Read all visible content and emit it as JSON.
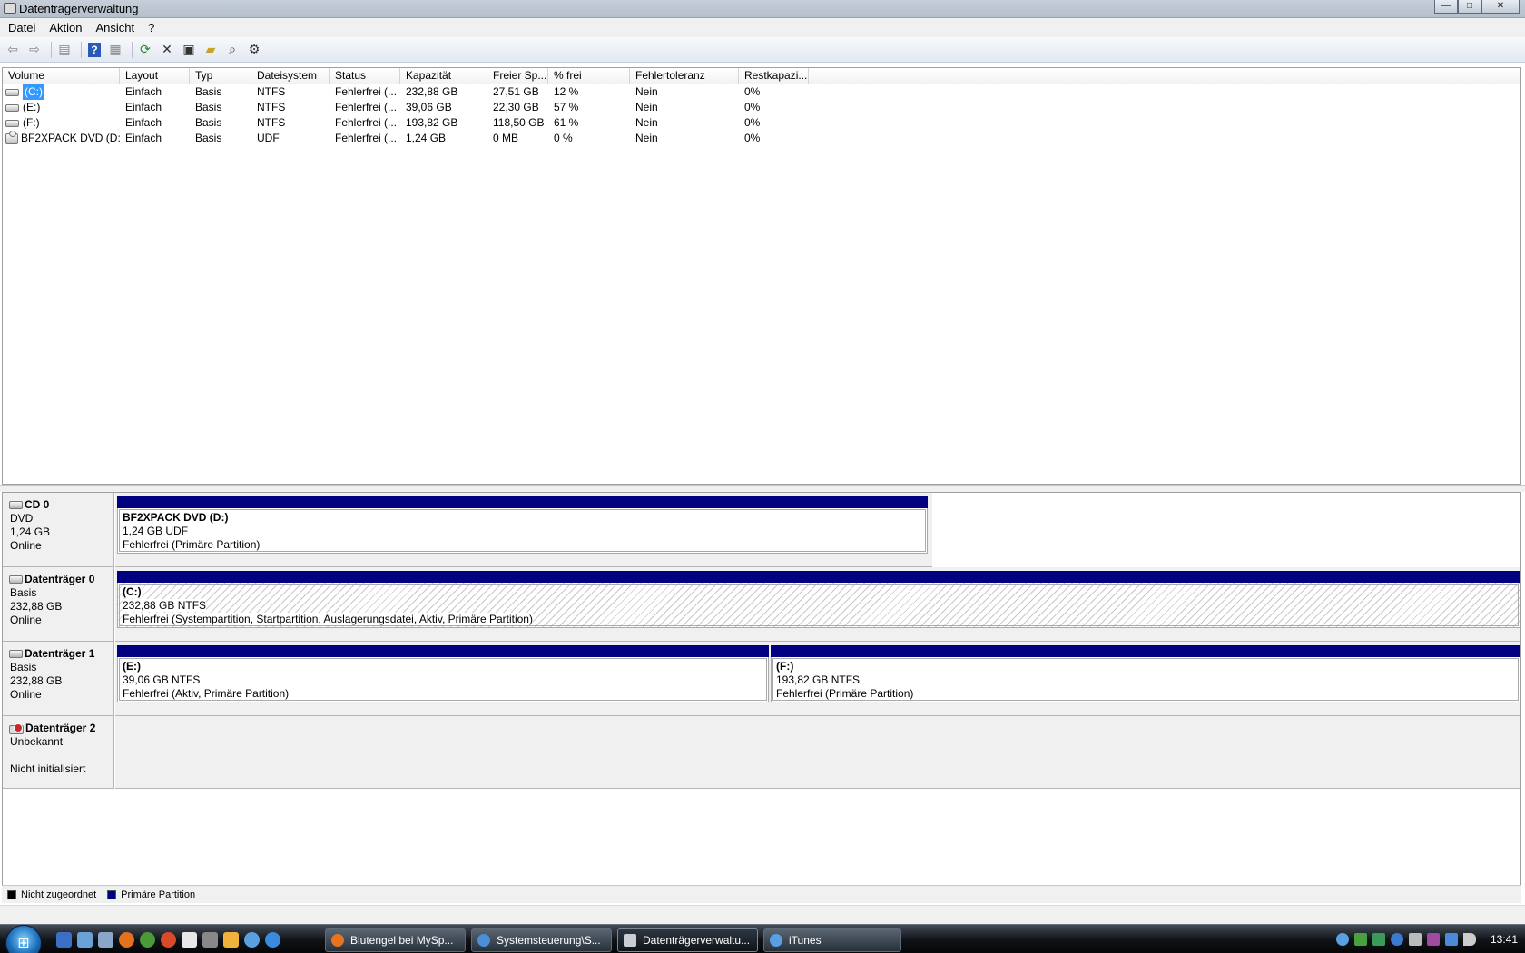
{
  "window": {
    "title": "Datenträgerverwaltung",
    "btn_minimize": "—",
    "btn_maximize": "□",
    "btn_close": "✕"
  },
  "menu": [
    "Datei",
    "Aktion",
    "Ansicht",
    "?"
  ],
  "toolbar": [
    "back-arrow-icon",
    "forward-arrow-icon",
    "show-hide-console-tree-icon",
    "help-icon",
    "properties-pane-icon",
    "refresh-icon",
    "delete-icon",
    "properties-icon",
    "open-icon",
    "explore-icon",
    "settings-icon"
  ],
  "volume_list": {
    "columns": [
      "Volume",
      "Layout",
      "Typ",
      "Dateisystem",
      "Status",
      "Kapazität",
      "Freier Sp...",
      "% frei",
      "Fehlertoleranz",
      "Restkapazi..."
    ],
    "rows": [
      {
        "volume": "(C:)",
        "layout": "Einfach",
        "typ": "Basis",
        "fs": "NTFS",
        "status": "Fehlerfrei (...",
        "kapazitaet": "232,88 GB",
        "frei": "27,51 GB",
        "prozent": "12 %",
        "fehlertoleranz": "Nein",
        "rest": "0%",
        "selected": true
      },
      {
        "volume": "(E:)",
        "layout": "Einfach",
        "typ": "Basis",
        "fs": "NTFS",
        "status": "Fehlerfrei (...",
        "kapazitaet": "39,06 GB",
        "frei": "22,30 GB",
        "prozent": "57 %",
        "fehlertoleranz": "Nein",
        "rest": "0%",
        "selected": false
      },
      {
        "volume": "(F:)",
        "layout": "Einfach",
        "typ": "Basis",
        "fs": "NTFS",
        "status": "Fehlerfrei (...",
        "kapazitaet": "193,82 GB",
        "frei": "118,50 GB",
        "prozent": "61 %",
        "fehlertoleranz": "Nein",
        "rest": "0%",
        "selected": false
      },
      {
        "volume": "BF2XPACK DVD (D:)",
        "layout": "Einfach",
        "typ": "Basis",
        "fs": "UDF",
        "status": "Fehlerfrei (...",
        "kapazitaet": "1,24 GB",
        "frei": "0 MB",
        "prozent": "0 %",
        "fehlertoleranz": "Nein",
        "rest": "0%",
        "selected": false
      }
    ]
  },
  "disks": {
    "cd0": {
      "name": "CD 0",
      "type": "DVD",
      "size": "1,24 GB",
      "state": "Online",
      "partition": {
        "name": "BF2XPACK DVD  (D:)",
        "size": "1,24 GB UDF",
        "status": "Fehlerfrei (Primäre Partition)"
      }
    },
    "disk0": {
      "name": "Datenträger 0",
      "type": "Basis",
      "size": "232,88 GB",
      "state": "Online",
      "partition": {
        "name": "(C:)",
        "size": "232,88 GB NTFS",
        "status": "Fehlerfrei (Systempartition, Startpartition, Auslagerungsdatei, Aktiv, Primäre Partition)"
      }
    },
    "disk1": {
      "name": "Datenträger 1",
      "type": "Basis",
      "size": "232,88 GB",
      "state": "Online",
      "partitions": [
        {
          "name": "(E:)",
          "size": "39,06 GB NTFS",
          "status": "Fehlerfrei (Aktiv, Primäre Partition)"
        },
        {
          "name": "(F:)",
          "size": "193,82 GB NTFS",
          "status": "Fehlerfrei (Primäre Partition)"
        }
      ]
    },
    "disk2": {
      "name": "Datenträger 2",
      "type": "Unbekannt",
      "state": "Nicht initialisiert"
    }
  },
  "legend": {
    "unallocated": "Nicht zugeordnet",
    "primary": "Primäre Partition",
    "unallocated_color": "#000000",
    "primary_color": "#000080"
  },
  "taskbar": {
    "tasks": [
      {
        "label": "Blutengel bei MySp...",
        "icon_color": "#e8741d"
      },
      {
        "label": "Systemsteuerung\\S...",
        "icon_color": "#4a8fd8"
      },
      {
        "label": "Datenträgerverwaltu...",
        "icon_color": "#c9ced4",
        "active": true
      },
      {
        "label": "iTunes",
        "icon_color": "#5aa0e0"
      }
    ],
    "clock": "13:41"
  }
}
